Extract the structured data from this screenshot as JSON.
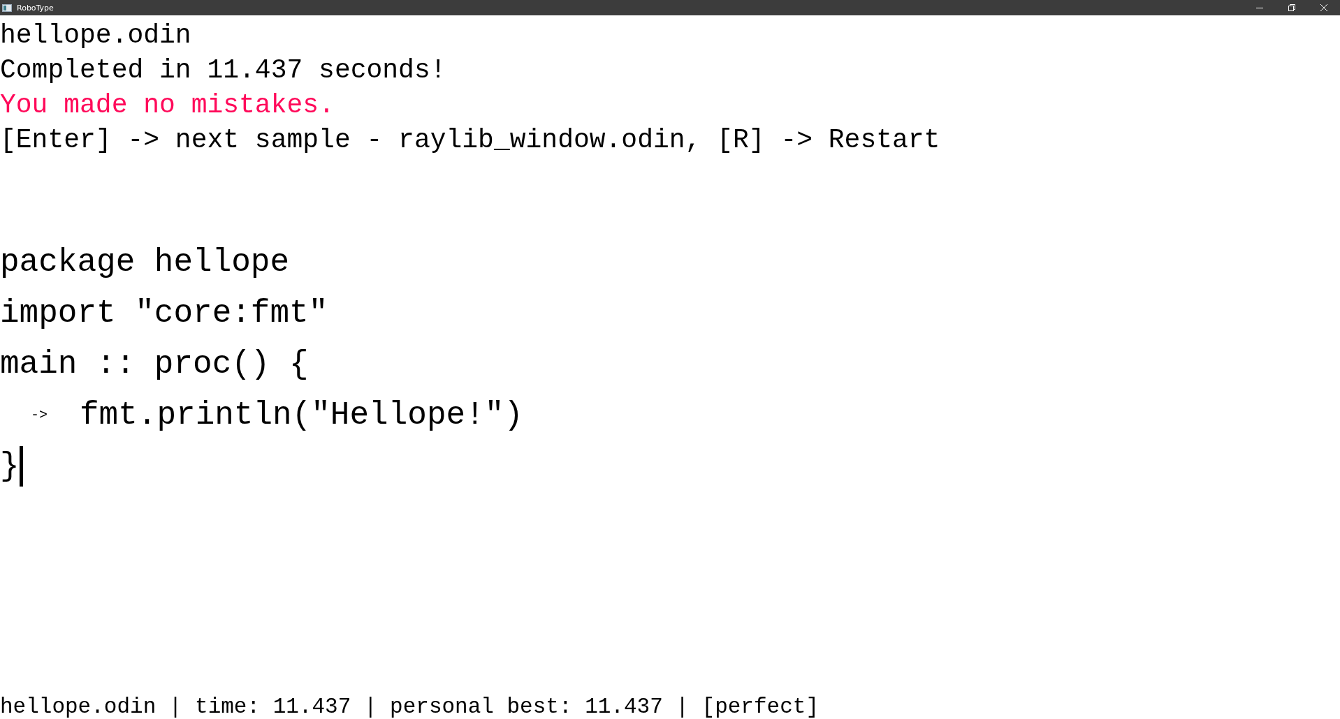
{
  "window": {
    "title": "RoboType"
  },
  "summary": [
    {
      "kind": "plain",
      "text": "hellope.odin"
    },
    {
      "kind": "plain",
      "text": "Completed in 11.437 seconds!"
    },
    {
      "kind": "highlight",
      "text": "You made no mistakes."
    },
    {
      "kind": "plain",
      "text": "[Enter] -> next sample - raylib_window.odin, [R] -> Restart"
    }
  ],
  "code_lines": [
    {
      "text": "package hellope",
      "cursor": false
    },
    {
      "text": "import \"core:fmt\"",
      "cursor": false
    },
    {
      "text": "main :: proc() {",
      "cursor": false
    },
    {
      "tab_marker": "->",
      "text": "fmt.println(\"Hellope!\")",
      "cursor": false
    },
    {
      "text": "}",
      "cursor": true
    }
  ],
  "status_bar": "hellope.odin | time: 11.437 | personal best: 11.437 | [perfect]"
}
